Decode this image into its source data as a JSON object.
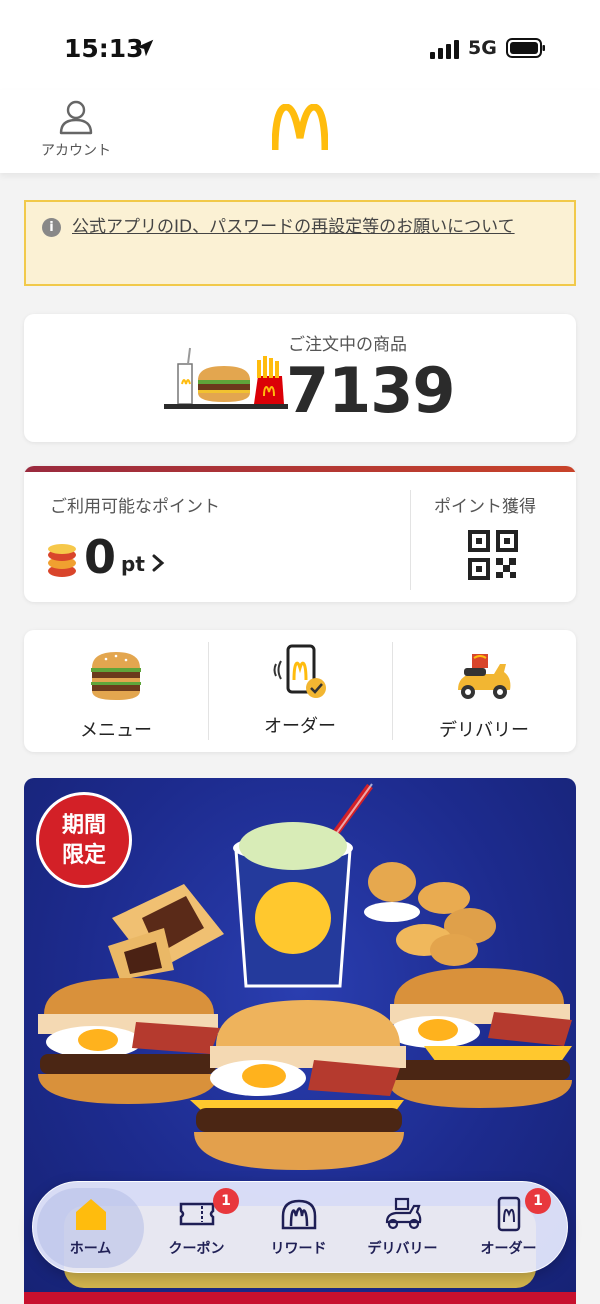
{
  "status_bar": {
    "time": "15:13",
    "network": "5G"
  },
  "header": {
    "account_label": "アカウント"
  },
  "notice": {
    "text": "公式アプリのID、パスワードの再設定等のお願いについて"
  },
  "order": {
    "label": "ご注文中の商品",
    "number": "7139"
  },
  "points": {
    "label": "ご利用可能なポイント",
    "value": "0",
    "unit": "pt",
    "earn_label": "ポイント獲得"
  },
  "quick_actions": [
    {
      "label": "メニュー",
      "icon": "burger-icon"
    },
    {
      "label": "オーダー",
      "icon": "mobile-order-icon"
    },
    {
      "label": "デリバリー",
      "icon": "delivery-scooter-icon"
    }
  ],
  "promo": {
    "badge_line1": "期間",
    "badge_line2": "限定"
  },
  "tabs": [
    {
      "label": "ホーム",
      "icon": "home-icon",
      "active": true,
      "badge": ""
    },
    {
      "label": "クーポン",
      "icon": "coupon-icon",
      "active": false,
      "badge": "1"
    },
    {
      "label": "リワード",
      "icon": "reward-icon",
      "active": false,
      "badge": ""
    },
    {
      "label": "デリバリー",
      "icon": "delivery-icon",
      "active": false,
      "badge": ""
    },
    {
      "label": "オーダー",
      "icon": "order-icon",
      "active": false,
      "badge": "1"
    }
  ],
  "colors": {
    "brand_yellow": "#ffbc0d",
    "brand_red": "#db0007",
    "notice_bg": "#fbf1d4",
    "badge_red": "#e8383d"
  }
}
